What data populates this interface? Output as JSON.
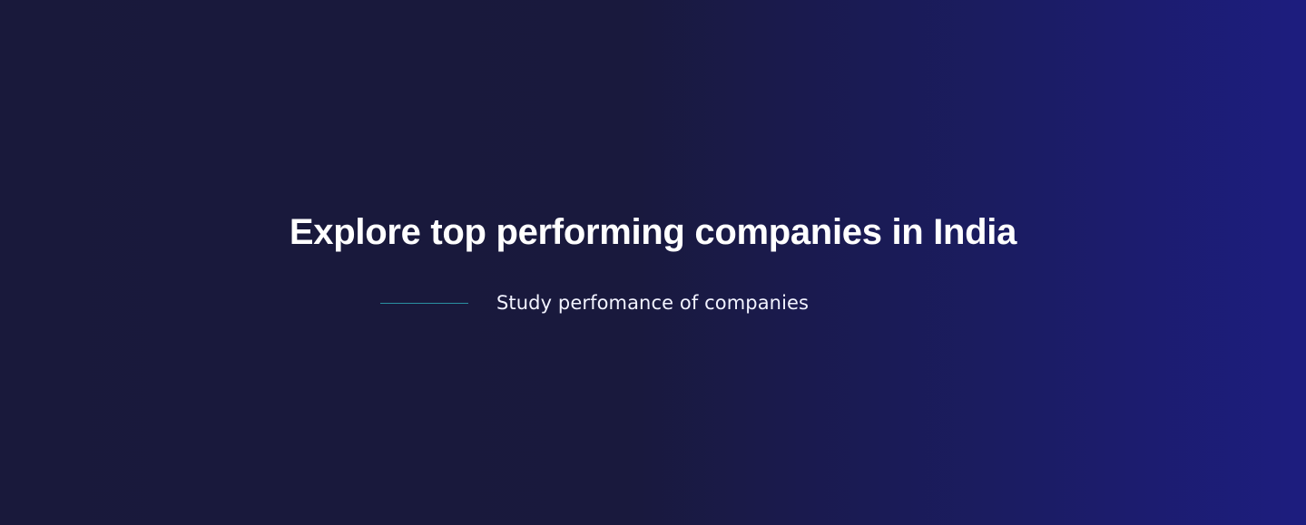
{
  "hero": {
    "title": "Explore top performing companies in India",
    "subtitle": "Study perfomance of companies"
  },
  "colors": {
    "background_left": "#19193b",
    "background_right": "#1d1d7f",
    "accent_line": "#2a8fa1",
    "text": "#ffffff"
  }
}
